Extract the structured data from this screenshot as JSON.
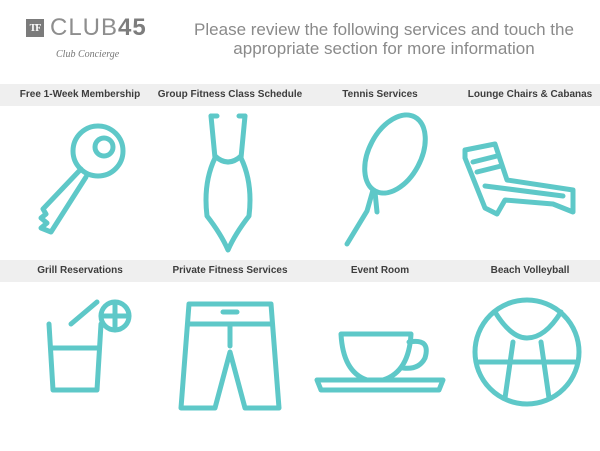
{
  "brand": {
    "mark": "TF",
    "name_light": "CLUB",
    "name_bold": "45",
    "subtitle": "Club Concierge"
  },
  "headline": "Please review the following services and touch the appropriate section for more information",
  "services": [
    {
      "label": "Free 1-Week Membership",
      "icon": "key-icon"
    },
    {
      "label": "Group Fitness Class Schedule",
      "icon": "swimsuit-icon"
    },
    {
      "label": "Tennis Services",
      "icon": "tennis-racket-icon"
    },
    {
      "label": "Lounge Chairs & Cabanas",
      "icon": "lounge-chair-icon"
    },
    {
      "label": "Grill Reservations",
      "icon": "drink-glass-icon"
    },
    {
      "label": "Private Fitness Services",
      "icon": "shorts-icon"
    },
    {
      "label": "Event Room",
      "icon": "teacup-icon"
    },
    {
      "label": "Beach Volleyball",
      "icon": "volleyball-icon"
    }
  ],
  "colors": {
    "accent": "#5ec8c8",
    "label_bar": "#efefef",
    "headline": "#8a8a8a"
  }
}
